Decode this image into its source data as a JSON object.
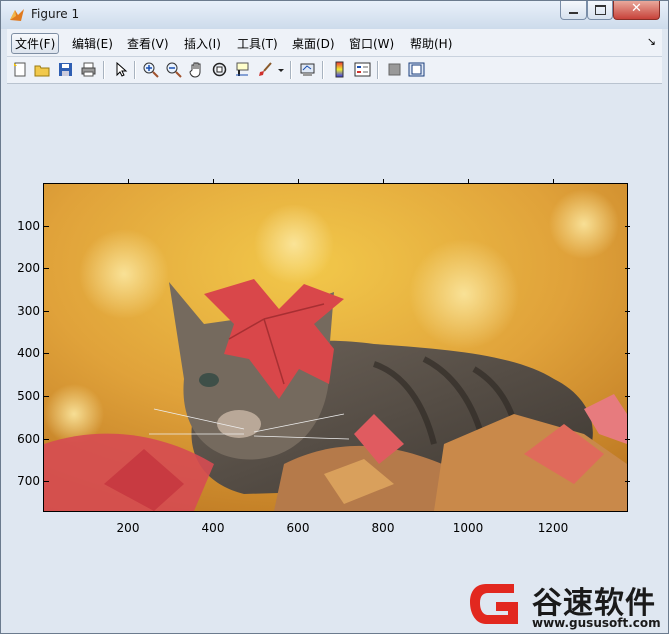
{
  "window": {
    "title": "Figure 1"
  },
  "menu": {
    "items": [
      {
        "label": "文件(F)",
        "active": true
      },
      {
        "label": "编辑(E)"
      },
      {
        "label": "查看(V)"
      },
      {
        "label": "插入(I)"
      },
      {
        "label": "工具(T)"
      },
      {
        "label": "桌面(D)"
      },
      {
        "label": "窗口(W)"
      },
      {
        "label": "帮助(H)"
      }
    ],
    "arrow": "↘"
  },
  "toolbar": {
    "icons": [
      "new-figure-icon",
      "open-file-icon",
      "save-icon",
      "print-icon",
      "pointer-icon",
      "zoom-in-icon",
      "zoom-out-icon",
      "pan-icon",
      "rotate-3d-icon",
      "data-cursor-icon",
      "brush-icon",
      "link-plot-icon",
      "colorbar-icon",
      "legend-icon",
      "hide-plot-tools-icon",
      "show-plot-tools-icon"
    ]
  },
  "axes": {
    "yticks": [
      "100",
      "200",
      "300",
      "400",
      "500",
      "600",
      "700"
    ],
    "xticks": [
      "200",
      "400",
      "600",
      "800",
      "1000",
      "1200"
    ]
  },
  "image": {
    "subject": "cat"
  },
  "watermark": {
    "brand": "谷速软件",
    "url": "www.gususoft.com"
  }
}
